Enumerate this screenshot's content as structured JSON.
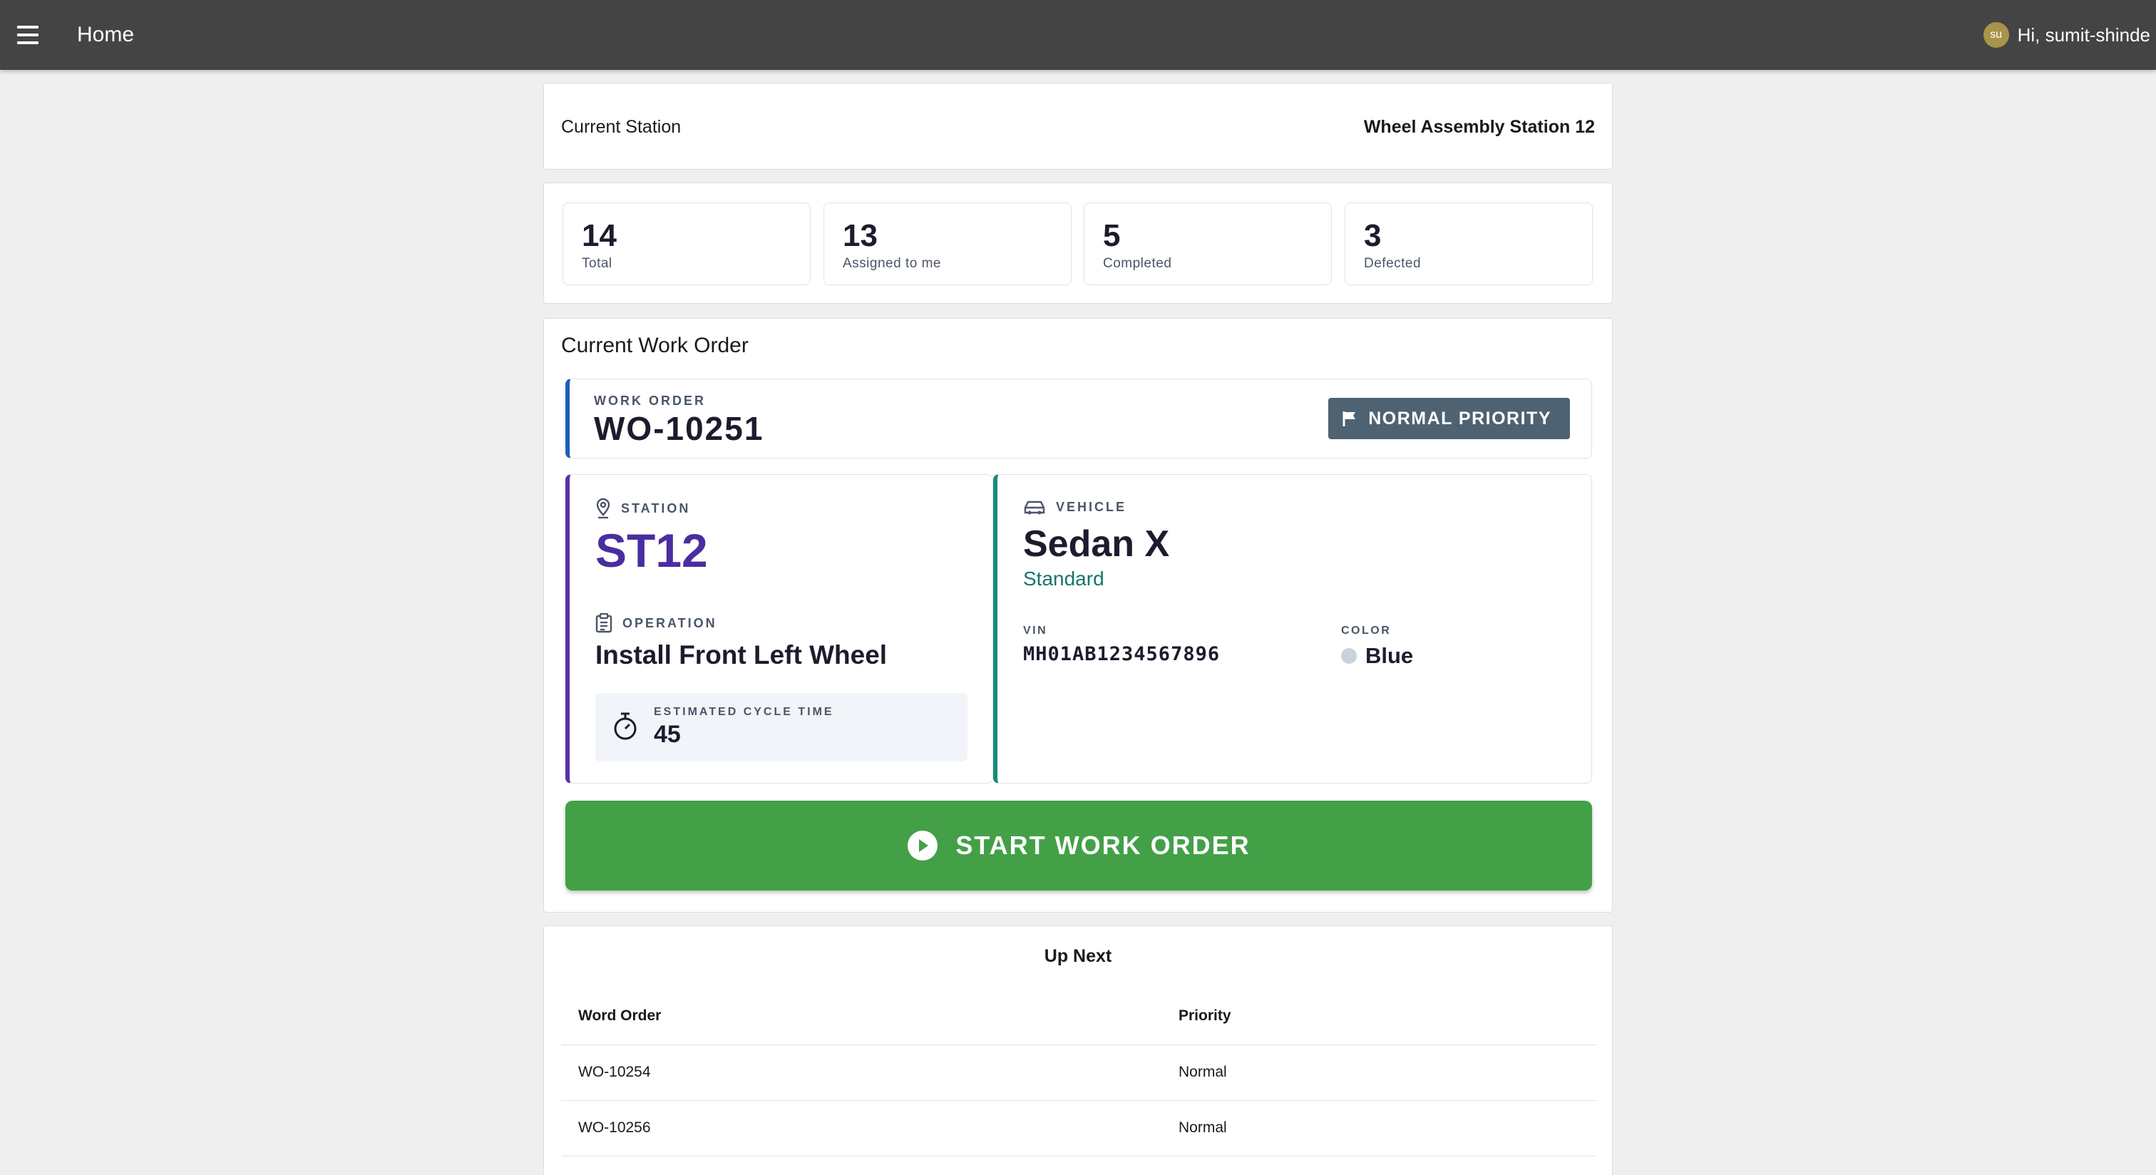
{
  "appbar": {
    "menu_icon": "menu-icon",
    "title": "Home",
    "user_initials": "su",
    "greeting": "Hi, sumit-shinde"
  },
  "station": {
    "label": "Current Station",
    "value": "Wheel Assembly Station 12"
  },
  "stats": [
    {
      "value": "14",
      "label": "Total"
    },
    {
      "value": "13",
      "label": "Assigned to me"
    },
    {
      "value": "5",
      "label": "Completed"
    },
    {
      "value": "3",
      "label": "Defected"
    }
  ],
  "work_order": {
    "section_title": "Current Work Order",
    "label": "WORK ORDER",
    "number": "WO-10251",
    "priority": "NORMAL PRIORITY",
    "priority_icon": "flag-icon",
    "accent_colors": {
      "header": "#1e5fb4",
      "station": "#5a2fa8",
      "vehicle": "#178a7a",
      "start": "#43a047"
    },
    "station_label": "STATION",
    "station_code": "ST12",
    "operation_label": "OPERATION",
    "operation": "Install Front Left Wheel",
    "cycle_label": "ESTIMATED CYCLE TIME",
    "cycle_value": "45",
    "vehicle_label": "VEHICLE",
    "vehicle_model": "Sedan X",
    "vehicle_trim": "Standard",
    "vin_label": "VIN",
    "vin": "MH01AB1234567896",
    "color_label": "COLOR",
    "color": "Blue",
    "start_label": "START WORK ORDER"
  },
  "up_next": {
    "title": "Up Next",
    "columns": [
      "Word Order",
      "Priority"
    ],
    "rows": [
      [
        "WO-10254",
        "Normal"
      ],
      [
        "WO-10256",
        "Normal"
      ]
    ]
  }
}
